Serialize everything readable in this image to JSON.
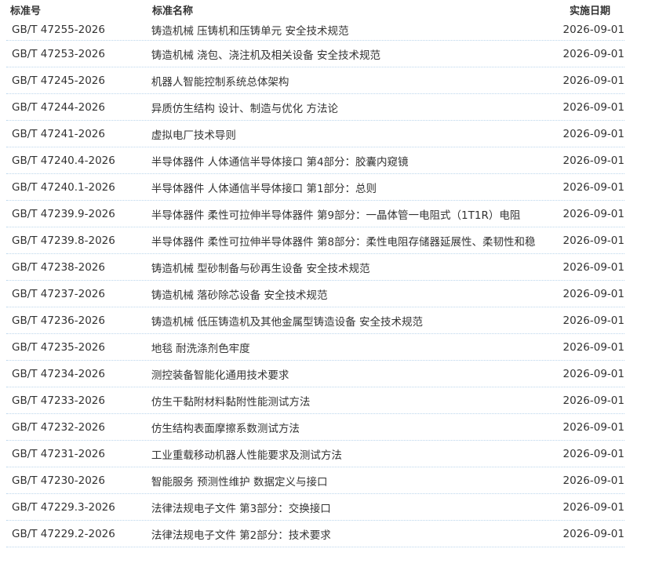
{
  "header": {
    "code_label": "标准号",
    "name_label": "标准名称",
    "date_label": "实施日期"
  },
  "rows": [
    {
      "code": "GB/T 47255-2026",
      "name": "铸造机械 压铸机和压铸单元 安全技术规范",
      "date": "2026-09-01"
    },
    {
      "code": "GB/T 47253-2026",
      "name": "铸造机械 浇包、浇注机及相关设备 安全技术规范",
      "date": "2026-09-01"
    },
    {
      "code": "GB/T 47245-2026",
      "name": "机器人智能控制系统总体架构",
      "date": "2026-09-01"
    },
    {
      "code": "GB/T 47244-2026",
      "name": "异质仿生结构 设计、制造与优化 方法论",
      "date": "2026-09-01"
    },
    {
      "code": "GB/T 47241-2026",
      "name": "虚拟电厂技术导则",
      "date": "2026-09-01"
    },
    {
      "code": "GB/T 47240.4-2026",
      "name": "半导体器件 人体通信半导体接口 第4部分：胶囊内窥镜",
      "date": "2026-09-01"
    },
    {
      "code": "GB/T 47240.1-2026",
      "name": "半导体器件 人体通信半导体接口 第1部分：总则",
      "date": "2026-09-01"
    },
    {
      "code": "GB/T 47239.9-2026",
      "name": "半导体器件 柔性可拉伸半导体器件 第9部分：一晶体管一电阻式（1T1R）电阻",
      "date": "2026-09-01"
    },
    {
      "code": "GB/T 47239.8-2026",
      "name": "半导体器件 柔性可拉伸半导体器件 第8部分：柔性电阻存储器延展性、柔韧性和稳",
      "date": "2026-09-01"
    },
    {
      "code": "GB/T 47238-2026",
      "name": "铸造机械 型砂制备与砂再生设备 安全技术规范",
      "date": "2026-09-01"
    },
    {
      "code": "GB/T 47237-2026",
      "name": "铸造机械 落砂除芯设备 安全技术规范",
      "date": "2026-09-01"
    },
    {
      "code": "GB/T 47236-2026",
      "name": "铸造机械 低压铸造机及其他金属型铸造设备 安全技术规范",
      "date": "2026-09-01"
    },
    {
      "code": "GB/T 47235-2026",
      "name": "地毯 耐洗涤剂色牢度",
      "date": "2026-09-01"
    },
    {
      "code": "GB/T 47234-2026",
      "name": "测控装备智能化通用技术要求",
      "date": "2026-09-01"
    },
    {
      "code": "GB/T 47233-2026",
      "name": "仿生干黏附材料黏附性能测试方法",
      "date": "2026-09-01"
    },
    {
      "code": "GB/T 47232-2026",
      "name": "仿生结构表面摩擦系数测试方法",
      "date": "2026-09-01"
    },
    {
      "code": "GB/T 47231-2026",
      "name": "工业重载移动机器人性能要求及测试方法",
      "date": "2026-09-01"
    },
    {
      "code": "GB/T 47230-2026",
      "name": "智能服务 预测性维护 数据定义与接口",
      "date": "2026-09-01"
    },
    {
      "code": "GB/T 47229.3-2026",
      "name": "法律法规电子文件 第3部分：交换接口",
      "date": "2026-09-01"
    },
    {
      "code": "GB/T 47229.2-2026",
      "name": "法律法规电子文件 第2部分：技术要求",
      "date": "2026-09-01"
    }
  ]
}
